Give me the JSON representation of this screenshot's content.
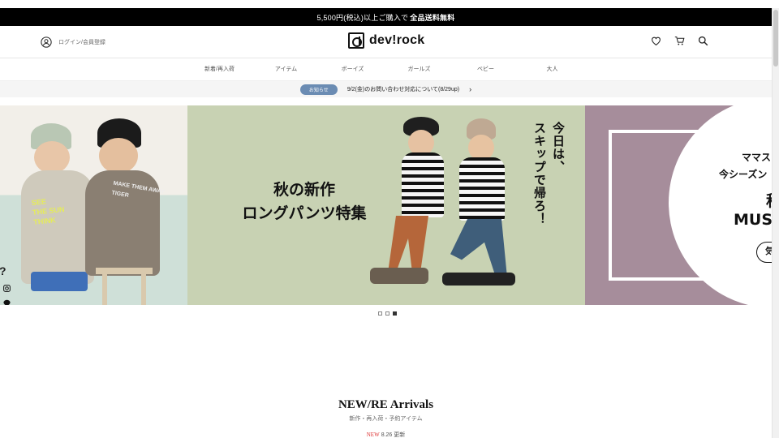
{
  "promo": {
    "text_prefix": "5,500円(税込)以上ご購入で",
    "text_strong": "全品送料無料"
  },
  "header": {
    "login_label": "ログイン/会員登録",
    "brand_word": "dev!rock",
    "icons": [
      "heart-icon",
      "cart-icon",
      "search-icon"
    ]
  },
  "nav": {
    "items": [
      "新着/再入荷",
      "アイテム",
      "ボーイズ",
      "ガールズ",
      "ベビー",
      "大人"
    ]
  },
  "notice": {
    "badge": "お知らせ",
    "text": "9/2(金)のお問い合わせ対応について(8/29up)"
  },
  "hero": {
    "left": {
      "print_front": "SEE\nTHE SUN\nTHINK",
      "print_back": "MAKE THEM AWAY\nTIGER"
    },
    "center": {
      "title_line1": "秋の新作",
      "title_line2": "ロングパンツ特集",
      "vertical_1": "今日は、",
      "vertical_2": "スキップで帰ろ！"
    },
    "right": {
      "line1": "ママス",
      "line2": "今シーズン",
      "line3": "秋",
      "line4": "MUS",
      "button": "気"
    }
  },
  "social": [
    "instagram-icon",
    "line-icon",
    "app-icon",
    "twitter-icon"
  ],
  "carousel": {
    "total": 3,
    "active_index": 2
  },
  "arrivals": {
    "title": "NEW/RE Arrivals",
    "subtitle": "新作・再入荷・予約アイテム",
    "new_label": "NEW",
    "update_text": "8.26 更新"
  },
  "colors": {
    "promo_bg": "#000000",
    "badge_bg": "#6b8cb3",
    "hero_center_bg": "#c8d2b3",
    "hero_right_bg": "#a68d9b",
    "new_red": "#dd3333"
  }
}
